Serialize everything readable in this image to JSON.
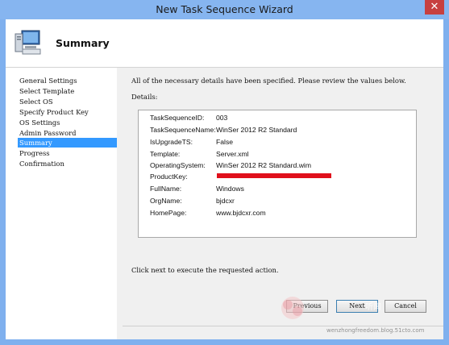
{
  "window": {
    "title": "New Task Sequence Wizard"
  },
  "header": {
    "title": "Summary"
  },
  "nav": {
    "items": [
      {
        "label": "General Settings",
        "selected": false
      },
      {
        "label": "Select Template",
        "selected": false
      },
      {
        "label": "Select OS",
        "selected": false
      },
      {
        "label": "Specify Product Key",
        "selected": false
      },
      {
        "label": "OS Settings",
        "selected": false
      },
      {
        "label": "Admin Password",
        "selected": false
      },
      {
        "label": "Summary",
        "selected": true
      },
      {
        "label": "Progress",
        "selected": false
      },
      {
        "label": "Confirmation",
        "selected": false
      }
    ]
  },
  "main": {
    "message": "All of the necessary details have been specified.  Please review the values below.",
    "details_label": "Details:",
    "details": [
      {
        "key": "TaskSequenceID:",
        "value": "003"
      },
      {
        "key": "TaskSequenceName:",
        "value": "WinSer 2012 R2 Standard"
      },
      {
        "key": "IsUpgradeTS:",
        "value": "False"
      },
      {
        "key": "Template:",
        "value": "Server.xml"
      },
      {
        "key": "OperatingSystem:",
        "value": "WinSer 2012 R2 Standard.wim"
      },
      {
        "key": "ProductKey:",
        "value": ""
      },
      {
        "key": "FullName:",
        "value": "Windows"
      },
      {
        "key": "OrgName:",
        "value": "bjdcxr"
      },
      {
        "key": "HomePage:",
        "value": "www.bjdcxr.com"
      }
    ],
    "footer_message": "Click next to execute the requested action."
  },
  "buttons": {
    "previous": "Previous",
    "next": "Next",
    "cancel": "Cancel"
  },
  "colors": {
    "selection": "#3399ff",
    "redaction": "#e0101c",
    "frame": "#7fb0ee"
  }
}
